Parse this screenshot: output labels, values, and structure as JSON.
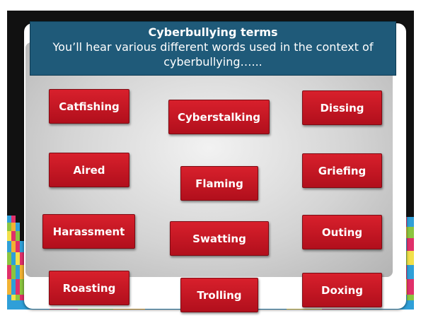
{
  "title_box": {
    "heading": "Cyberbullying terms",
    "subtitle": "You’ll hear various different words used in the context of cyberbullying…..."
  },
  "terms": [
    "Catfishing",
    "Cyberstalking",
    "Dissing",
    "Aired",
    "Flaming",
    "Griefing",
    "Harassment",
    "Swatting",
    "Outing",
    "Roasting",
    "Trolling",
    "Doxing"
  ],
  "colors": {
    "title_bg": "#1f5a79",
    "term_bg": "#c4151f",
    "slide_bg": "#111111"
  }
}
